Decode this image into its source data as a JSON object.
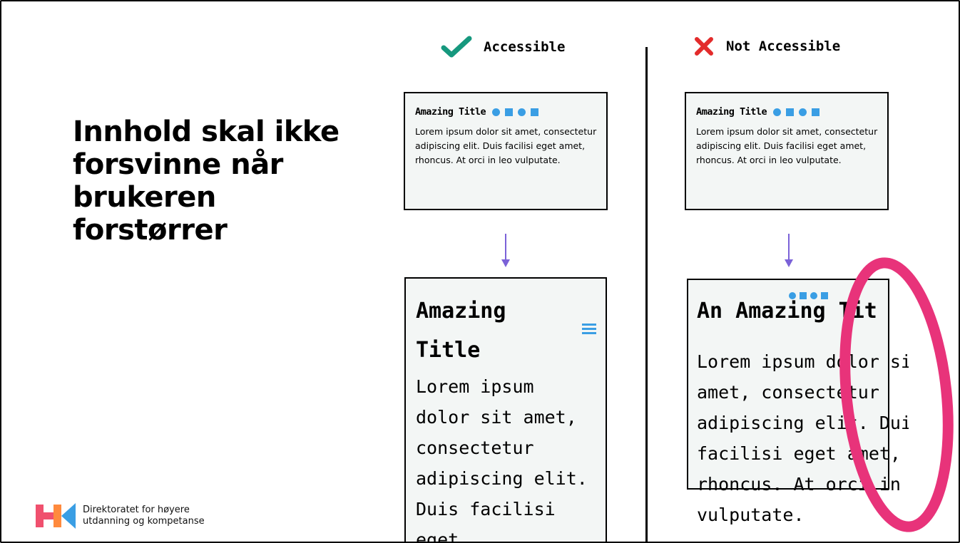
{
  "slide": {
    "heading": "Innhold skal ikke forsvinne når brukeren forstørrer",
    "logo": {
      "line1": "Direktoratet for høyere",
      "line2": "utdanning og kompetanse",
      "colors": {
        "pink": "#f0506e",
        "orange": "#ff8a3d",
        "blue": "#3a9ee4"
      }
    }
  },
  "accessible": {
    "label": "Accessible",
    "icon": "checkmark-icon",
    "icon_color": "#16987e",
    "small_card": {
      "title": "Amazing Title",
      "body": "Lorem ipsum dolor sit amet, consectetur adipiscing elit. Duis facilisi eget amet, rhoncus. At orci in leo vulputate."
    },
    "big_card": {
      "title": "Amazing Title",
      "body_lines": [
        "Lorem ipsum",
        "dolor sit amet,",
        "consectetur",
        "adipiscing elit.",
        "Duis facilisi eget"
      ],
      "menu_icon": "hamburger-icon"
    }
  },
  "not_accessible": {
    "label": "Not Accessible",
    "icon": "cross-icon",
    "icon_color": "#e32b2b",
    "small_card": {
      "title": "Amazing Title",
      "body": "Lorem ipsum dolor sit amet, consectetur adipiscing elit. Duis facilisi eget amet, rhoncus. At orci in leo vulputate."
    },
    "big_card": {
      "title": "An Amazing Tit",
      "body_lines": [
        "Lorem ipsum dolor si",
        "amet, consectetur",
        "adipiscing elit. Duis",
        "facilisi eget amet,",
        "rhoncus. At orci in le",
        "vulputate."
      ]
    },
    "highlight_color": "#e8337a"
  },
  "arrow_color": "#7b62d8"
}
